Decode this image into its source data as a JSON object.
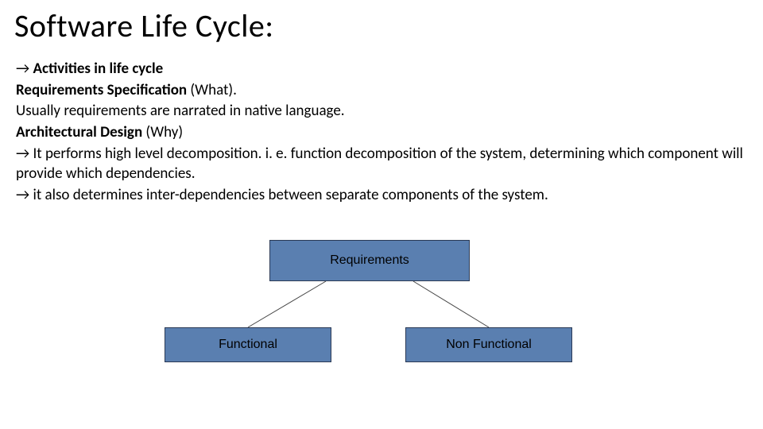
{
  "title": "Software Life Cycle:",
  "body": {
    "l1_prefix": "→ ",
    "l1_bold": "Activities in  life cycle",
    "l2_bold": "Requirements Specification",
    "l2_rest": " (What).",
    "l3": "Usually requirements are narrated in native language.",
    "l4_bold": "Architectural Design",
    "l4_rest": " (Why)",
    "l5": "→ It performs high level decomposition. i. e. function decomposition of the system, determining which component will provide which dependencies.",
    "l6": "→ it also determines inter-dependencies between separate components of the system."
  },
  "diagram": {
    "root": "Requirements",
    "left": "Functional",
    "right": "Non Functional"
  }
}
